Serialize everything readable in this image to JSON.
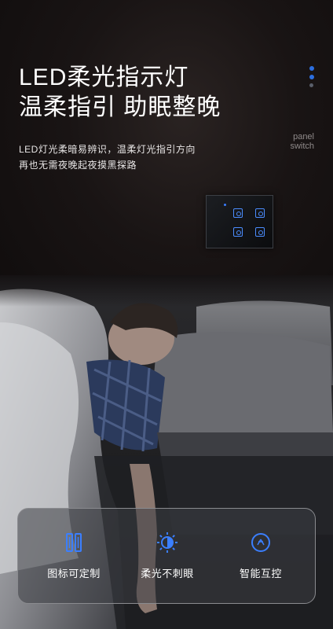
{
  "headline": {
    "line1": "LED柔光指示灯",
    "line2": "温柔指引 助眠整晚"
  },
  "panel_label": {
    "line1": "panel",
    "line2": "switch"
  },
  "description": {
    "line1": "LED灯光柔暗易辨识，温柔灯光指引方向",
    "line2": "再也无需夜晚起夜摸黑探路"
  },
  "features": [
    {
      "label": "图标可定制",
      "icon": "customize-icon"
    },
    {
      "label": "柔光不刺眼",
      "icon": "soft-light-icon"
    },
    {
      "label": "智能互控",
      "icon": "smart-control-icon"
    }
  ],
  "colors": {
    "accent": "#2c6fe0",
    "icon_blue": "#3b7fff",
    "background": "#120f10"
  }
}
